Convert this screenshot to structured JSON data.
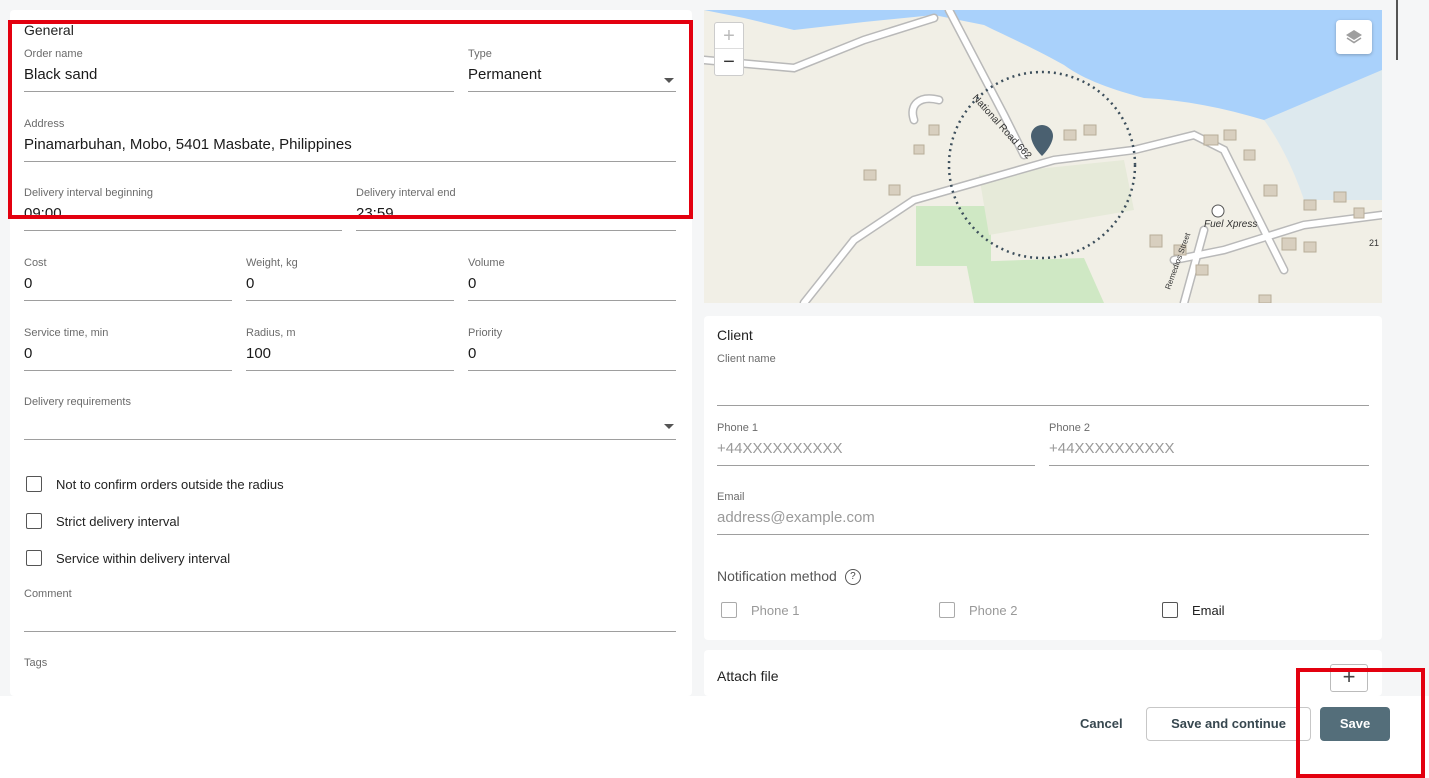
{
  "general": {
    "title": "General",
    "order_name": {
      "label": "Order name",
      "value": "Black sand"
    },
    "type": {
      "label": "Type",
      "value": "Permanent"
    },
    "address": {
      "label": "Address",
      "value": "Pinamarbuhan, Mobo, 5401 Masbate, Philippines"
    },
    "interval_begin": {
      "label": "Delivery interval beginning",
      "value": "09:00"
    },
    "interval_end": {
      "label": "Delivery interval end",
      "value": "23:59"
    },
    "cost": {
      "label": "Cost",
      "value": "0"
    },
    "weight": {
      "label": "Weight, kg",
      "value": "0"
    },
    "volume": {
      "label": "Volume",
      "value": "0"
    },
    "service_time": {
      "label": "Service time, min",
      "value": "0"
    },
    "radius": {
      "label": "Radius, m",
      "value": "100"
    },
    "priority": {
      "label": "Priority",
      "value": "0"
    },
    "requirements": {
      "label": "Delivery requirements",
      "value": ""
    },
    "checkboxes": [
      {
        "label": "Not to confirm orders outside the radius",
        "checked": false
      },
      {
        "label": "Strict delivery interval",
        "checked": false
      },
      {
        "label": "Service within delivery interval",
        "checked": false
      }
    ],
    "comment": {
      "label": "Comment",
      "value": ""
    },
    "tags": {
      "label": "Tags"
    }
  },
  "map": {
    "zoom_in": "+",
    "zoom_out": "−",
    "labels": {
      "road": "National Road 662",
      "fuel": "Fuel Xpress",
      "street": "Remedios Street",
      "number": "21"
    },
    "colors": {
      "water": "#a9d1fb",
      "land": "#f1efe6",
      "green": "#cfe8c4",
      "road_border": "#b9b9b9",
      "marker": "#4a6070",
      "radius_ring": "#3d4f5c"
    }
  },
  "client": {
    "title": "Client",
    "client_name": {
      "label": "Client name",
      "value": ""
    },
    "phone1": {
      "label": "Phone 1",
      "placeholder": "+44XXXXXXXXXX"
    },
    "phone2": {
      "label": "Phone 2",
      "placeholder": "+44XXXXXXXXXX"
    },
    "email": {
      "label": "Email",
      "placeholder": "address@example.com"
    },
    "notification": {
      "title": "Notification method",
      "help_icon": "?",
      "options": [
        {
          "label": "Phone 1",
          "enabled": false
        },
        {
          "label": "Phone 2",
          "enabled": false
        },
        {
          "label": "Email",
          "enabled": true
        }
      ]
    }
  },
  "attach": {
    "title": "Attach file",
    "add_label": "+"
  },
  "footer": {
    "cancel": "Cancel",
    "save_continue": "Save and continue",
    "save": "Save"
  },
  "colors": {
    "highlight": "#e3000f",
    "primary_button": "#546e7a"
  }
}
